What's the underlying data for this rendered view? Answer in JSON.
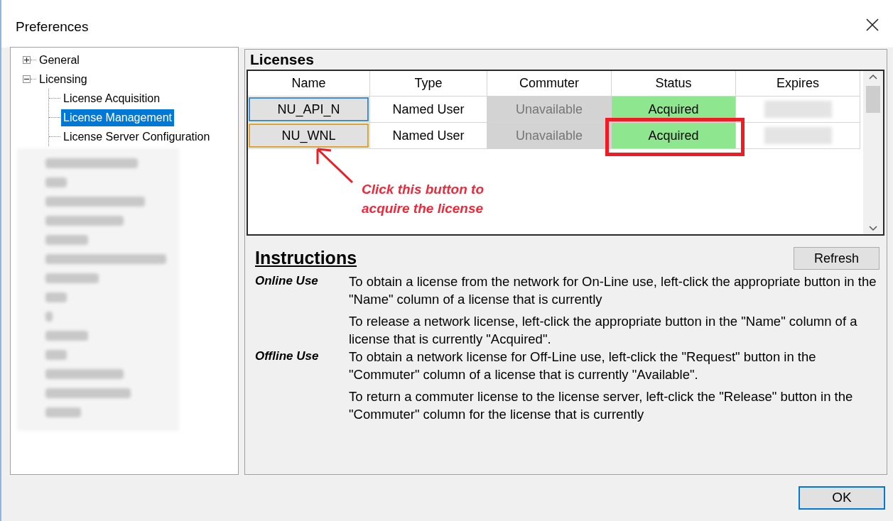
{
  "window": {
    "title": "Preferences"
  },
  "tree": [
    {
      "label": "General",
      "expanded": false,
      "selected": false
    },
    {
      "label": "Licensing",
      "expanded": true,
      "selected": false,
      "children": [
        {
          "label": "License Acquisition",
          "selected": false
        },
        {
          "label": "License Management",
          "selected": true
        },
        {
          "label": "License Server Configuration",
          "selected": false
        }
      ]
    }
  ],
  "licenses": {
    "heading": "Licenses",
    "columns": [
      "Name",
      "Type",
      "Commuter",
      "Status",
      "Expires"
    ],
    "rows": [
      {
        "name": "NU_API_N",
        "focused": true,
        "hovered": false,
        "type": "Named User",
        "commuter": "Unavailable",
        "commuter_disabled": true,
        "status": "Acquired",
        "color": "#8ee68e",
        "callout": false
      },
      {
        "name": "NU_WNL",
        "focused": false,
        "hovered": true,
        "type": "Named User",
        "commuter": "Unavailable",
        "commuter_disabled": true,
        "status": "Acquired",
        "color": "#8ee68e",
        "callout": true
      }
    ],
    "annotation": "Click this button to acquire the license"
  },
  "instructions": {
    "heading": "Instructions",
    "refresh_button": "Refresh",
    "sections": [
      {
        "label": "Online Use",
        "paragraphs": [
          "To obtain a license from the network for On-Line use, left-click the appropriate button in the \"Name\" column of a license that is currently",
          "To release a network license, left-click the appropriate button in the \"Name\" column of a license that is currently \"Acquired\"."
        ]
      },
      {
        "label": "Offline Use",
        "paragraphs": [
          "To obtain a network license for Off-Line use, left-click the \"Request\" button in the \"Commuter\" column of a license that is currently \"Available\".",
          "To return a commuter license to the license server, left-click the \"Release\" button in the \"Commuter\" column for the license that is currently"
        ]
      }
    ]
  },
  "buttons": {
    "ok": "OK"
  }
}
